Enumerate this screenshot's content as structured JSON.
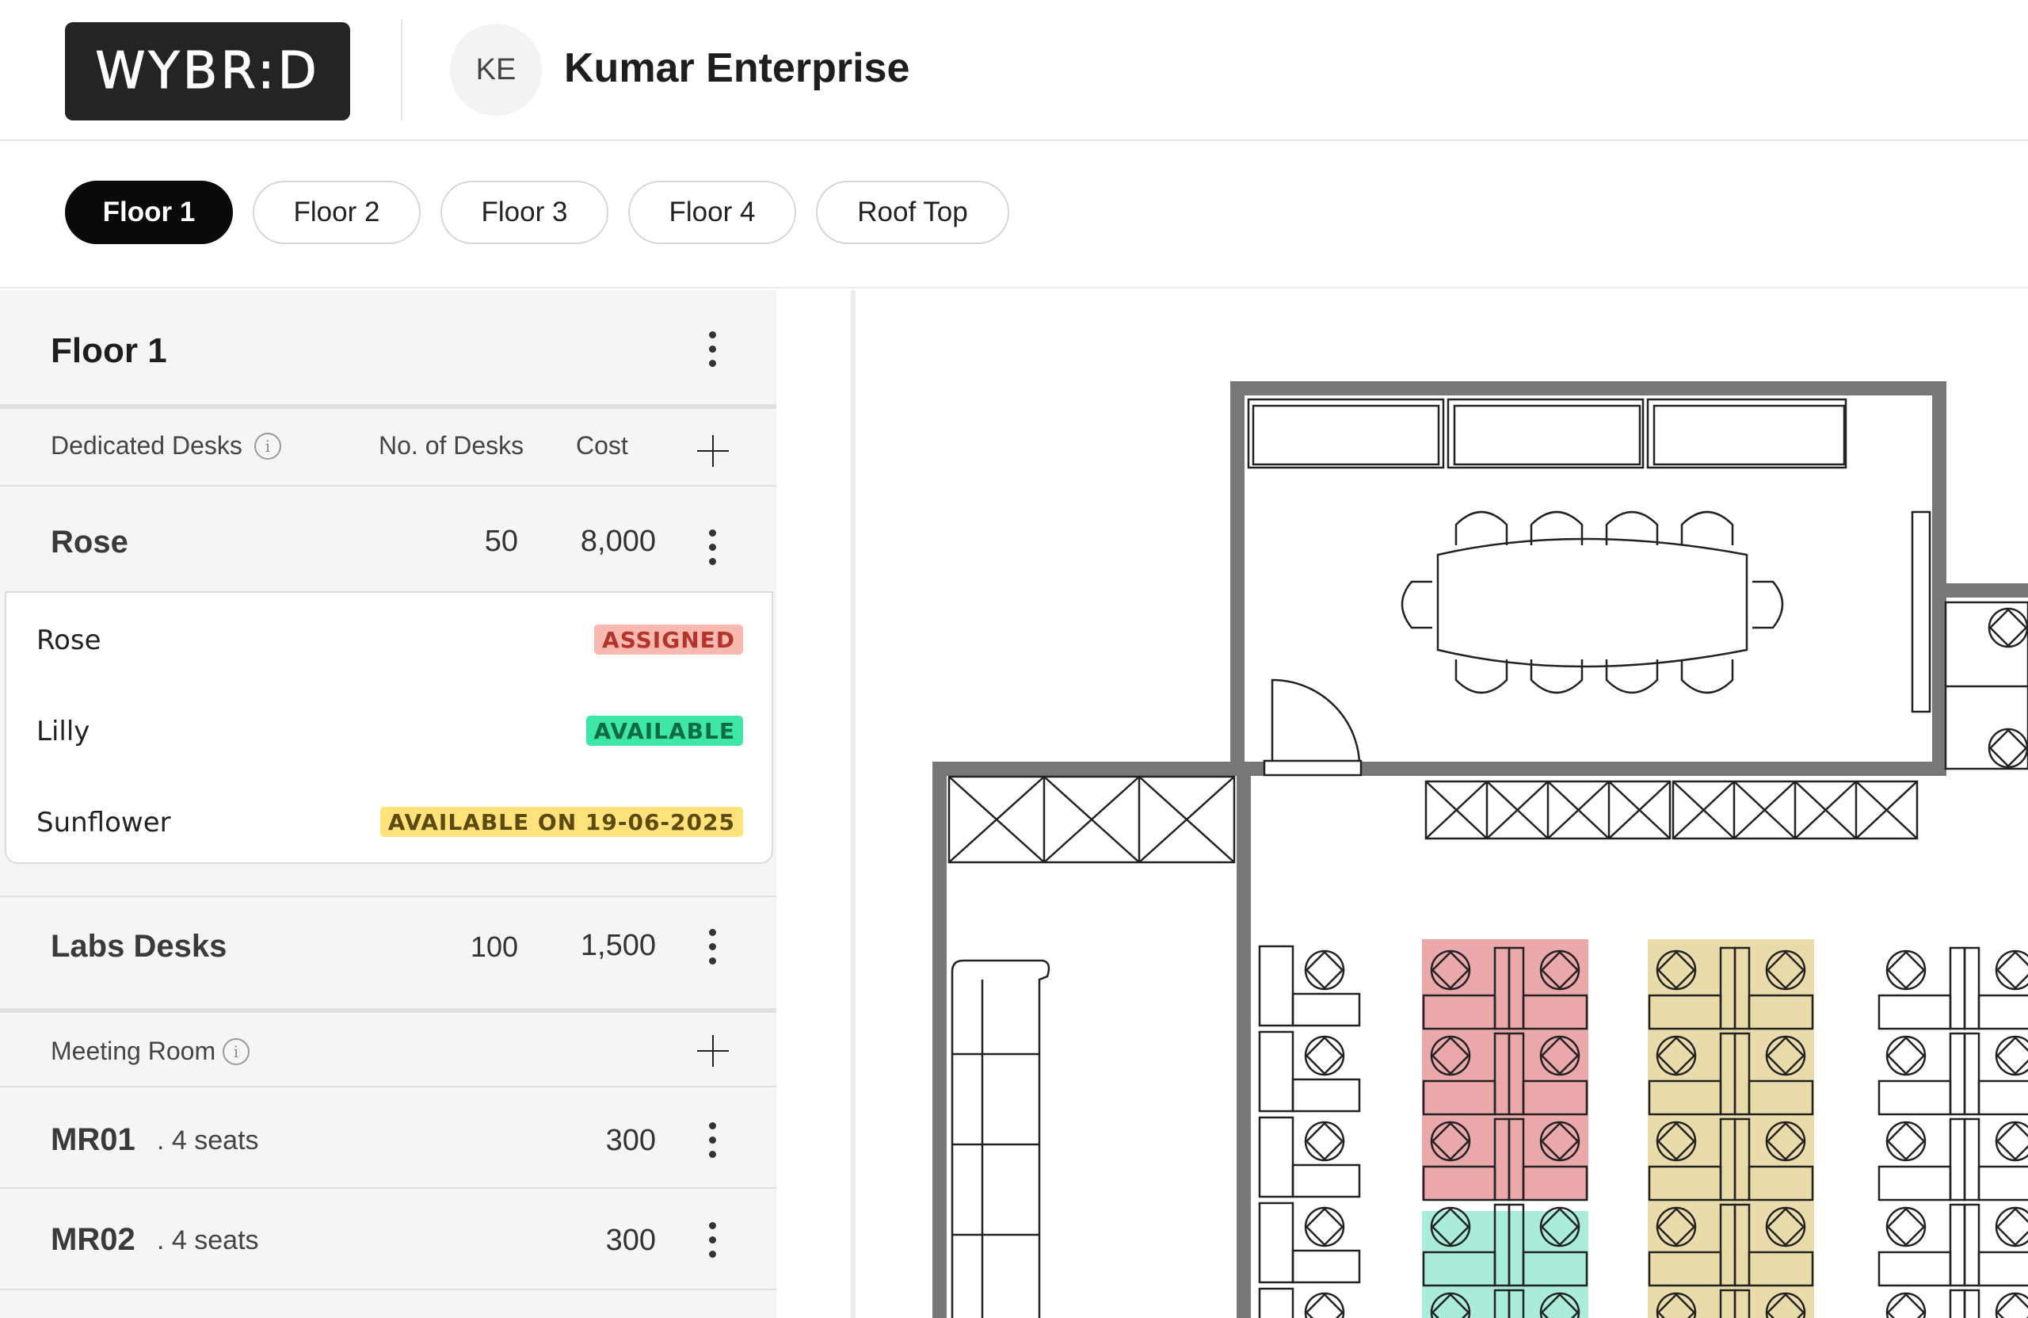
{
  "app": {
    "logo_text": "WYBR:D"
  },
  "company": {
    "initials": "KE",
    "name": "Kumar Enterprise"
  },
  "floors": [
    {
      "label": "Floor 1",
      "active": true
    },
    {
      "label": "Floor 2",
      "active": false
    },
    {
      "label": "Floor 3",
      "active": false
    },
    {
      "label": "Floor 4",
      "active": false
    },
    {
      "label": "Roof Top",
      "active": false
    }
  ],
  "panel": {
    "title": "Floor 1",
    "dedicated": {
      "label": "Dedicated Desks",
      "col_desks": "No. of Desks",
      "col_cost": "Cost",
      "info_glyph": "i"
    },
    "groups": [
      {
        "name": "Rose",
        "desks": "50",
        "cost": "8,000",
        "items": [
          {
            "name": "Rose",
            "status": "ASSIGNED",
            "status_color": "#f9b8b0"
          },
          {
            "name": "Lilly",
            "status": "AVAILABLE",
            "status_color": "#3fe7a6"
          },
          {
            "name": "Sunflower",
            "status": "AVAILABLE ON 19-06-2025",
            "status_color": "#ffe27a"
          }
        ]
      },
      {
        "name": "Labs Desks",
        "desks": "100",
        "cost": "1,500"
      }
    ],
    "meeting": {
      "label": "Meeting Room",
      "info_glyph": "i",
      "rooms": [
        {
          "name": "MR01",
          "seats": ". 4 seats",
          "cost": "300"
        },
        {
          "name": "MR02",
          "seats": ". 4 seats",
          "cost": "300"
        }
      ]
    }
  },
  "plan_zones": {
    "assigned_color": "#eba8ab",
    "available_color": "#a9ecd9",
    "soon_color": "#eadcaa"
  }
}
